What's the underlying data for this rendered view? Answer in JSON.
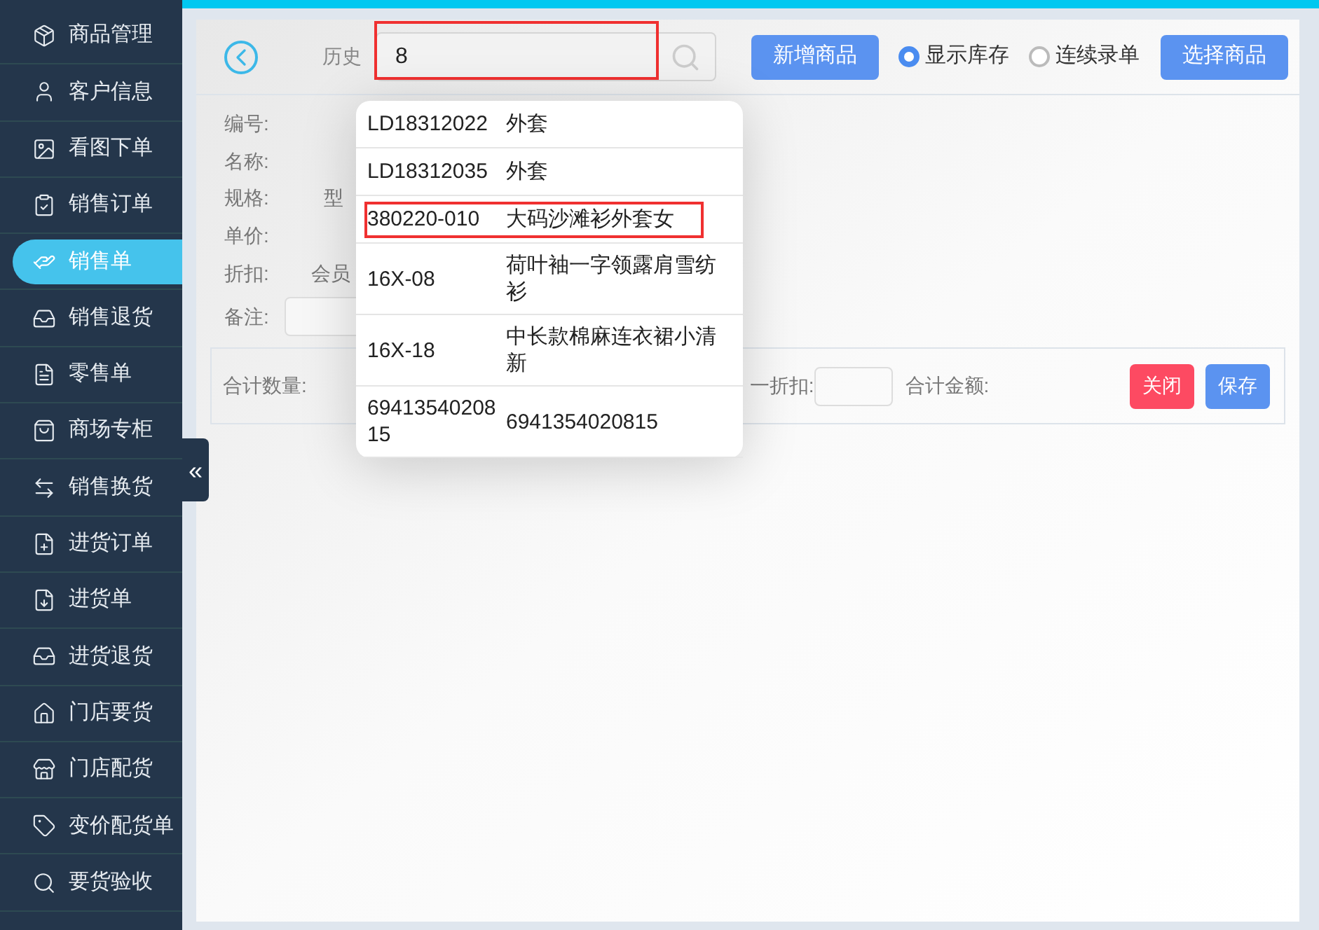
{
  "sidebar": {
    "items": [
      {
        "label": "商品管理",
        "selected": false
      },
      {
        "label": "客户信息",
        "selected": false
      },
      {
        "label": "看图下单",
        "selected": false
      },
      {
        "label": "销售订单",
        "selected": false
      },
      {
        "label": "销售单",
        "selected": true
      },
      {
        "label": "销售退货",
        "selected": false
      },
      {
        "label": "零售单",
        "selected": false
      },
      {
        "label": "商场专柜",
        "selected": false
      },
      {
        "label": "销售换货",
        "selected": false
      },
      {
        "label": "进货订单",
        "selected": false
      },
      {
        "label": "进货单",
        "selected": false
      },
      {
        "label": "进货退货",
        "selected": false
      },
      {
        "label": "门店要货",
        "selected": false
      },
      {
        "label": "门店配货",
        "selected": false
      },
      {
        "label": "变价配货单",
        "selected": false
      },
      {
        "label": "要货验收",
        "selected": false
      }
    ]
  },
  "header": {
    "history_label": "历史",
    "search": {
      "value": "8",
      "highlighted": true
    },
    "add_button": "新增商品",
    "radios": [
      {
        "label": "显示库存",
        "selected": true
      },
      {
        "label": "连续录单",
        "selected": false
      }
    ],
    "select_button": "选择商品"
  },
  "form": {
    "fields": [
      {
        "label": "编号:"
      },
      {
        "label": "名称:"
      },
      {
        "label": "规格:",
        "extra": "型"
      },
      {
        "label": "单价:"
      },
      {
        "label": "折扣:",
        "extra": "会员"
      }
    ],
    "note_label": "备注:"
  },
  "summary": {
    "quantity_label": "合计数量:",
    "discount_label": "一折扣:",
    "amount_label": "合计金额:",
    "close_button": "关闭",
    "save_button": "保存"
  },
  "suggestions": [
    {
      "code": "LD18312022",
      "name": "外套",
      "highlighted": false
    },
    {
      "code": "LD18312035",
      "name": "外套",
      "highlighted": false
    },
    {
      "code": "380220-010",
      "name": "大码沙滩衫外套女",
      "highlighted": true
    },
    {
      "code": "16X-08",
      "name": "荷叶袖一字领露肩雪纺衫",
      "highlighted": false
    },
    {
      "code": "16X-18",
      "name": "中长款棉麻连衣裙小清新",
      "highlighted": false
    },
    {
      "code": "6941354020815",
      "name": "6941354020815",
      "highlighted": false
    }
  ],
  "collapse_button": "«"
}
